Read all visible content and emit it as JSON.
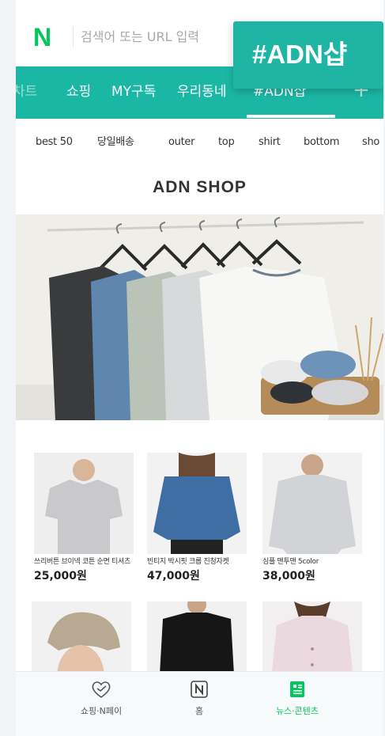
{
  "search": {
    "logo": "N",
    "placeholder": "검색어 또는 URL 입력"
  },
  "nav": {
    "tabs": [
      {
        "label": "차트"
      },
      {
        "label": "쇼핑"
      },
      {
        "label": "MY구독"
      },
      {
        "label": "우리동네"
      },
      {
        "label": "#ADN샵"
      }
    ],
    "plus": "+",
    "active_tab": "#ADN샵",
    "accent_color": "#1bb7a5"
  },
  "floating_label": "#ADN샵",
  "categories": [
    "best 50",
    "당일배송",
    "outer",
    "top",
    "shirt",
    "bottom",
    "sho"
  ],
  "shop_title": "ADN SHOP",
  "products": [
    {
      "name": "쓰리버튼 브이넥 코튼 순면 티셔츠",
      "price": "25,000원"
    },
    {
      "name": "빈티지 박시핏 크롭 진청자켓",
      "price": "47,000원"
    },
    {
      "name": "심플 맨투맨 5color",
      "price": "38,000원"
    },
    {
      "name": "",
      "price": ""
    },
    {
      "name": "",
      "price": ""
    },
    {
      "name": "",
      "price": ""
    }
  ],
  "bottom_nav": [
    {
      "label": "쇼핑·N페이",
      "icon": "heart-check-icon"
    },
    {
      "label": "홈",
      "icon": "naver-home-icon"
    },
    {
      "label": "뉴스·콘텐츠",
      "icon": "news-icon",
      "active": true
    }
  ]
}
